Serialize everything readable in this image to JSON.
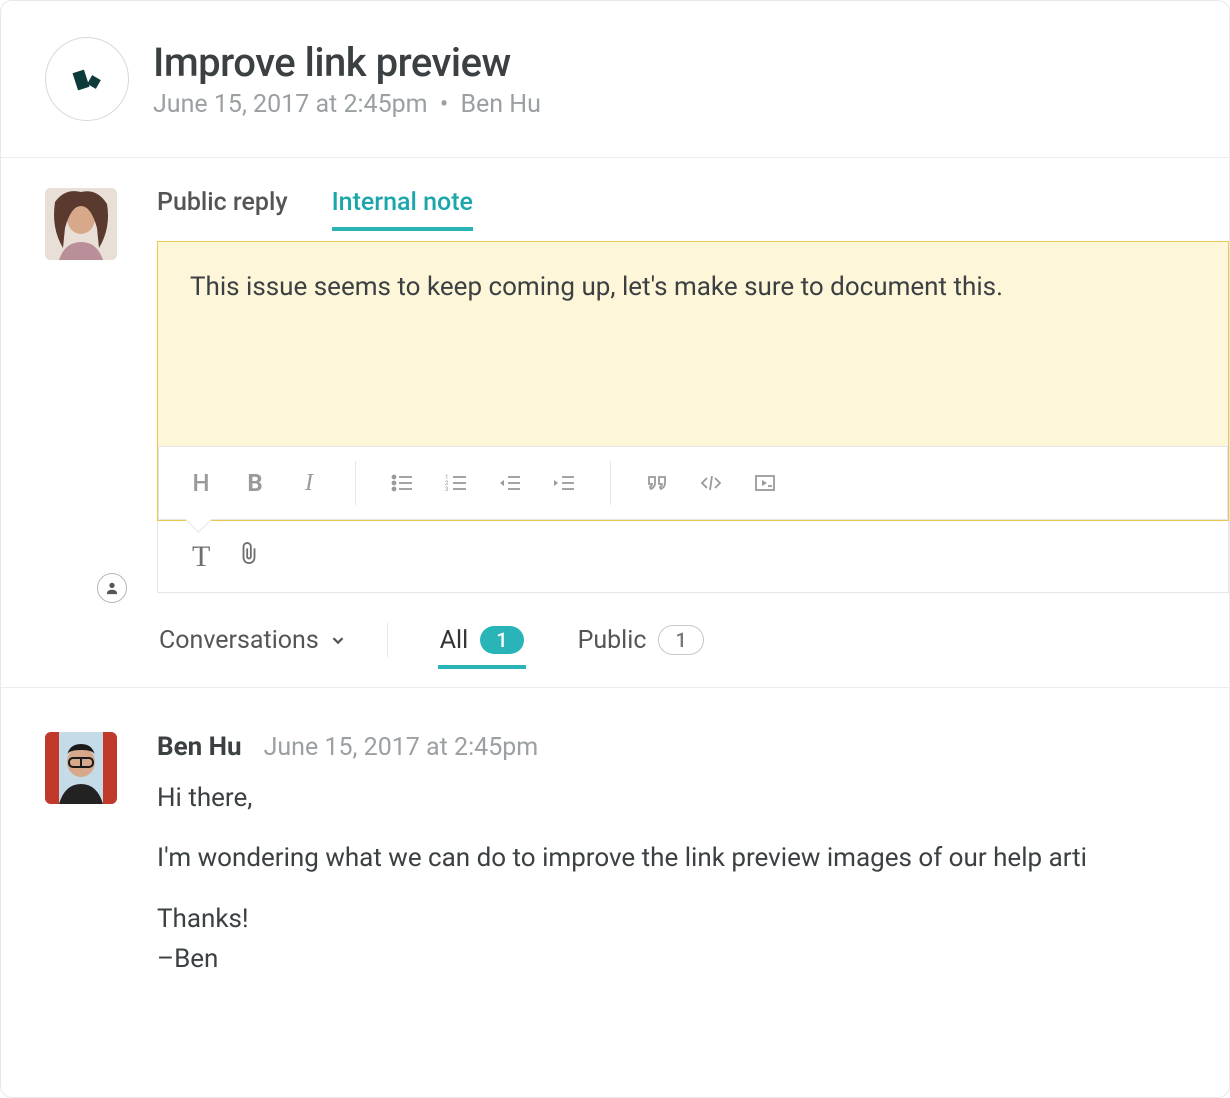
{
  "header": {
    "title": "Improve link preview",
    "timestamp": "June 15, 2017 at 2:45pm",
    "author": "Ben Hu"
  },
  "compose": {
    "tabs": {
      "public": "Public reply",
      "internal": "Internal note"
    },
    "note_text": "This issue seems to keep coming up, let's make sure to document this."
  },
  "filters": {
    "conversations_label": "Conversations",
    "all_label": "All",
    "all_count": "1",
    "public_label": "Public",
    "public_count": "1"
  },
  "entry": {
    "author": "Ben Hu",
    "timestamp": "June 15, 2017 at 2:45pm",
    "p1": "Hi there,",
    "p2": "I'm wondering what we can do to improve the link preview images of our help arti",
    "p3": "Thanks!",
    "p4": "–Ben"
  }
}
